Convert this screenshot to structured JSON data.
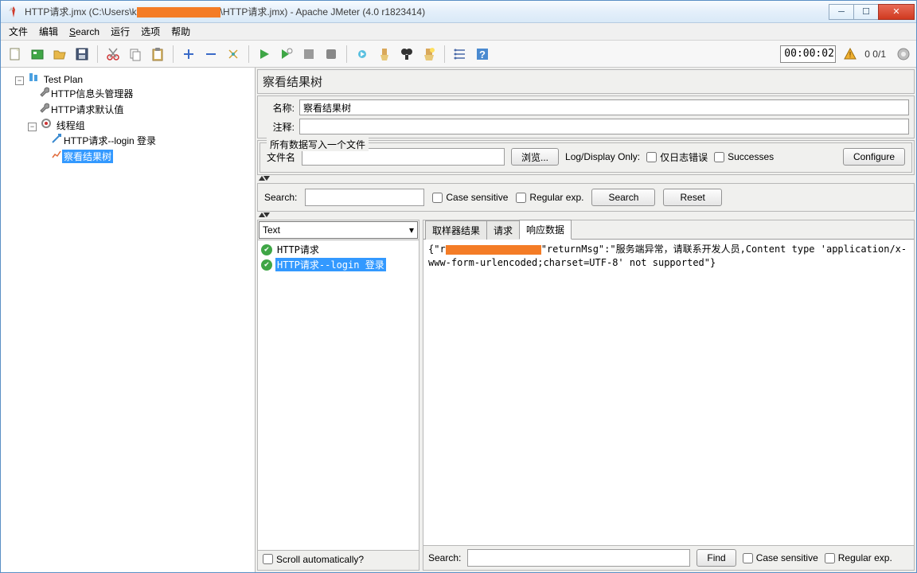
{
  "window": {
    "title_prefix": "HTTP请求.jmx (C:\\Users\\k",
    "title_suffix": "\\HTTP请求.jmx) - Apache JMeter (4.0 r1823414)"
  },
  "menu": {
    "file": "文件",
    "edit": "编辑",
    "search": "Search",
    "run": "运行",
    "options": "选项",
    "help": "帮助"
  },
  "toolbar": {
    "timer": "00:00:02",
    "counter": "0  0/1"
  },
  "tree": {
    "root": "Test Plan",
    "header_mgr": "HTTP信息头管理器",
    "defaults": "HTTP请求默认值",
    "thread_group": "线程组",
    "http_login": "HTTP请求--login 登录",
    "view_results": "察看结果树"
  },
  "panel": {
    "title": "察看结果树",
    "name_label": "名称:",
    "name_value": "察看结果树",
    "comment_label": "注释:",
    "comment_value": ""
  },
  "fileset": {
    "legend": "所有数据写入一个文件",
    "filename_label": "文件名",
    "browse": "浏览...",
    "logdisplay": "Log/Display Only:",
    "errors_only": "仅日志错误",
    "successes": "Successes",
    "configure": "Configure"
  },
  "search": {
    "label": "Search:",
    "case": "Case sensitive",
    "regex": "Regular exp.",
    "search_btn": "Search",
    "reset_btn": "Reset"
  },
  "results": {
    "combo": "Text",
    "item1": "HTTP请求",
    "item2": "HTTP请求--login 登录",
    "scroll_auto": "Scroll automatically?"
  },
  "tabs": {
    "sampler": "取样器结果",
    "request": "请求",
    "response": "响应数据"
  },
  "response": {
    "prefix": "{\"r",
    "suffix": "\"returnMsg\":\"服务端异常，请联系开发人员,Content type 'application/x-www-form-urlencoded;charset=UTF-8' not supported\"}"
  },
  "bottom_search": {
    "label": "Search:",
    "find": "Find",
    "case": "Case sensitive",
    "regex": "Regular exp."
  }
}
